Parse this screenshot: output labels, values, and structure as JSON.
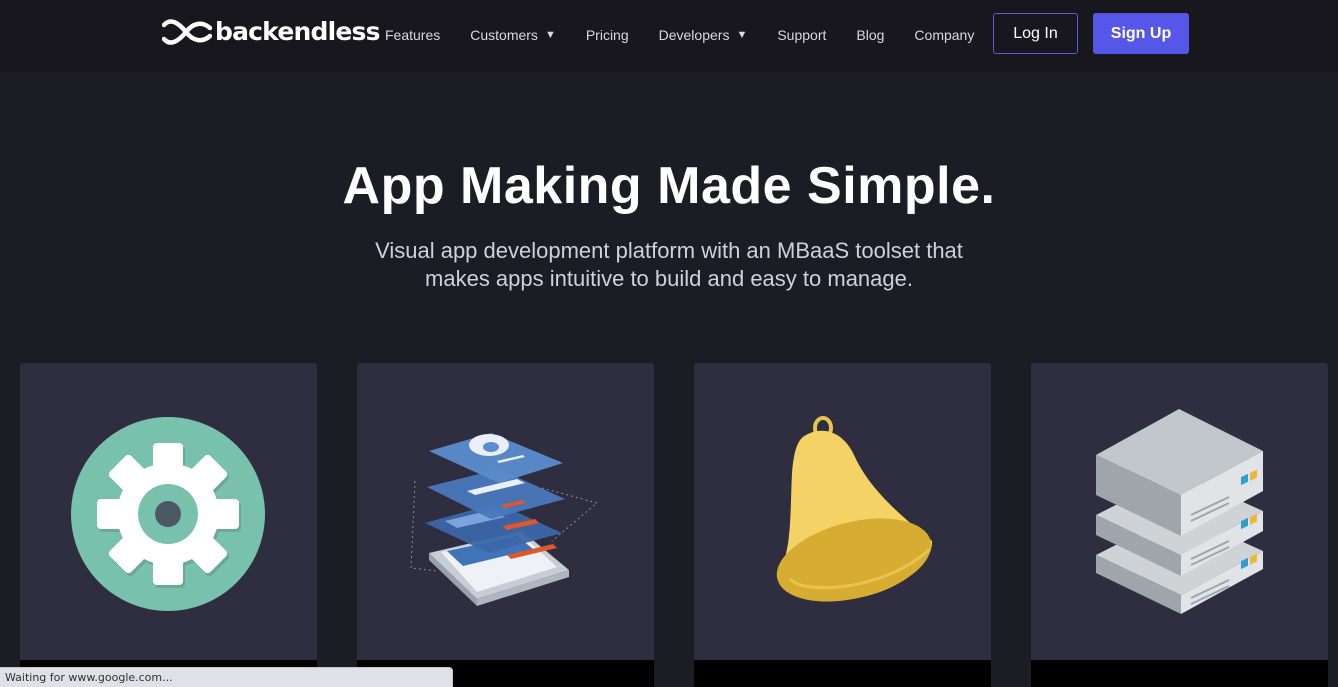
{
  "brand": {
    "name": "backendless"
  },
  "nav": {
    "items": [
      {
        "label": "Features",
        "has_dropdown": false
      },
      {
        "label": "Customers",
        "has_dropdown": true
      },
      {
        "label": "Pricing",
        "has_dropdown": false
      },
      {
        "label": "Developers",
        "has_dropdown": true
      },
      {
        "label": "Support",
        "has_dropdown": false
      },
      {
        "label": "Blog",
        "has_dropdown": false
      },
      {
        "label": "Company",
        "has_dropdown": false
      }
    ],
    "caret_glyph": "▼",
    "login_label": "Log In",
    "signup_label": "Sign Up"
  },
  "hero": {
    "title": "App Making Made Simple.",
    "subtitle_line1": "Visual app development platform with an MBaaS toolset that",
    "subtitle_line2": "makes apps intuitive to build and easy to manage."
  },
  "cards": [
    {
      "icon": "gear-icon"
    },
    {
      "icon": "app-layers-icon"
    },
    {
      "icon": "bell-icon"
    },
    {
      "icon": "server-icon"
    }
  ],
  "status_bar": {
    "text": "Waiting for www.google.com..."
  },
  "colors": {
    "background": "#1c1c24",
    "header": "#17171d",
    "card": "#2f2e40",
    "accent": "#5657e8"
  }
}
